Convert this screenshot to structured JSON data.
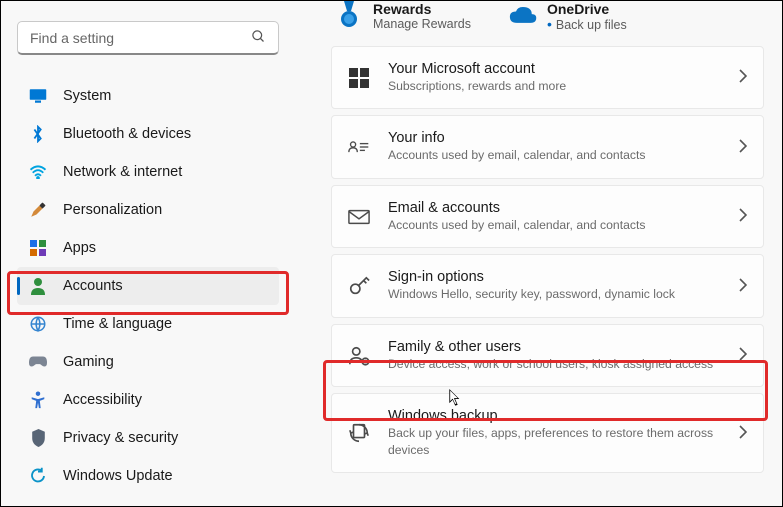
{
  "search": {
    "placeholder": "Find a setting"
  },
  "sidebar": {
    "items": [
      {
        "label": "System",
        "icon": "monitor-icon",
        "color": "#0078d4"
      },
      {
        "label": "Bluetooth & devices",
        "icon": "bluetooth-icon",
        "color": "#0078d4"
      },
      {
        "label": "Network & internet",
        "icon": "wifi-icon",
        "color": "#00a3e0"
      },
      {
        "label": "Personalization",
        "icon": "paintbrush-icon",
        "color": "#d46a00"
      },
      {
        "label": "Apps",
        "icon": "apps-grid-icon",
        "color": "#1a6fe8"
      },
      {
        "label": "Accounts",
        "icon": "person-icon",
        "color": "#2f8f3e"
      },
      {
        "label": "Time & language",
        "icon": "globe-time-icon",
        "color": "#3585d0"
      },
      {
        "label": "Gaming",
        "icon": "gamepad-icon",
        "color": "#7c8593"
      },
      {
        "label": "Accessibility",
        "icon": "accessibility-icon",
        "color": "#2f6fd0"
      },
      {
        "label": "Privacy & security",
        "icon": "shield-icon",
        "color": "#586576"
      },
      {
        "label": "Windows Update",
        "icon": "update-icon",
        "color": "#0b93c8"
      }
    ],
    "activeIndex": 5
  },
  "headerTiles": [
    {
      "title": "Rewards",
      "subtitle": "Manage Rewards",
      "icon": "medal-icon",
      "bulleted": false
    },
    {
      "title": "OneDrive",
      "subtitle": "Back up files",
      "icon": "cloud-icon",
      "bulleted": true
    }
  ],
  "cards": [
    {
      "icon": "microsoft-logo-icon",
      "title": "Your Microsoft account",
      "subtitle": "Subscriptions, rewards and more"
    },
    {
      "icon": "id-card-icon",
      "title": "Your info",
      "subtitle": "Accounts used by email, calendar, and contacts"
    },
    {
      "icon": "envelope-icon",
      "title": "Email & accounts",
      "subtitle": "Accounts used by email, calendar, and contacts"
    },
    {
      "icon": "key-icon",
      "title": "Sign-in options",
      "subtitle": "Windows Hello, security key, password, dynamic lock"
    },
    {
      "icon": "family-icon",
      "title": "Family & other users",
      "subtitle": "Device access, work or school users, kiosk assigned access"
    },
    {
      "icon": "backup-sync-icon",
      "title": "Windows backup",
      "subtitle": "Back up your files, apps, preferences to restore them across devices"
    }
  ],
  "highlightedCardIndex": 4
}
